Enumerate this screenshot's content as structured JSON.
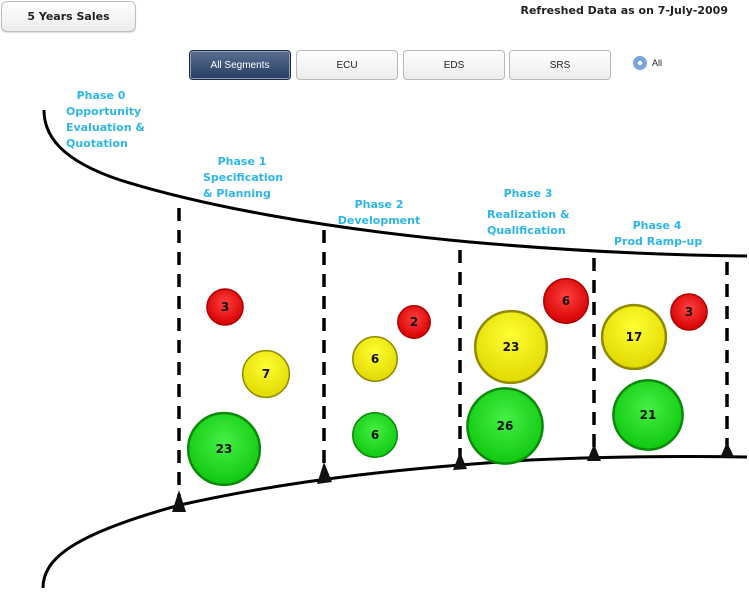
{
  "header": {
    "title_button": "5 Years Sales",
    "refreshed_text": "Refreshed Data as on 7-July-2009"
  },
  "segments": {
    "buttons": [
      {
        "label": "All Segments",
        "active": true
      },
      {
        "label": "ECU",
        "active": false
      },
      {
        "label": "EDS",
        "active": false
      },
      {
        "label": "SRS",
        "active": false
      }
    ],
    "radio": {
      "label": "All",
      "selected": true
    }
  },
  "phases": [
    {
      "lines": [
        "Phase 0",
        "Opportunity",
        "Evaluation &",
        "Quotation"
      ]
    },
    {
      "lines": [
        "Phase 1",
        "Specification",
        "& Planning"
      ]
    },
    {
      "lines": [
        "Phase 2",
        "Development"
      ]
    },
    {
      "lines": [
        "Phase 3",
        "Realization &",
        "Qualification"
      ]
    },
    {
      "lines": [
        "Phase 4",
        "Prod Ramp-up"
      ]
    }
  ],
  "colors": {
    "phase_text": "#2eb6ea",
    "red": "#e8141a",
    "yellow": "#f2ef14",
    "green": "#22dd22"
  },
  "chart_data": {
    "type": "bubble",
    "title": "",
    "categories": [
      "Phase 1",
      "Phase 2",
      "Phase 3",
      "Phase 4"
    ],
    "series": [
      {
        "name": "Red",
        "color": "#e8141a",
        "values": [
          3,
          2,
          6,
          3
        ]
      },
      {
        "name": "Yellow",
        "color": "#f2ef14",
        "values": [
          7,
          6,
          23,
          17
        ]
      },
      {
        "name": "Green",
        "color": "#22dd22",
        "values": [
          23,
          6,
          26,
          21
        ]
      }
    ]
  }
}
